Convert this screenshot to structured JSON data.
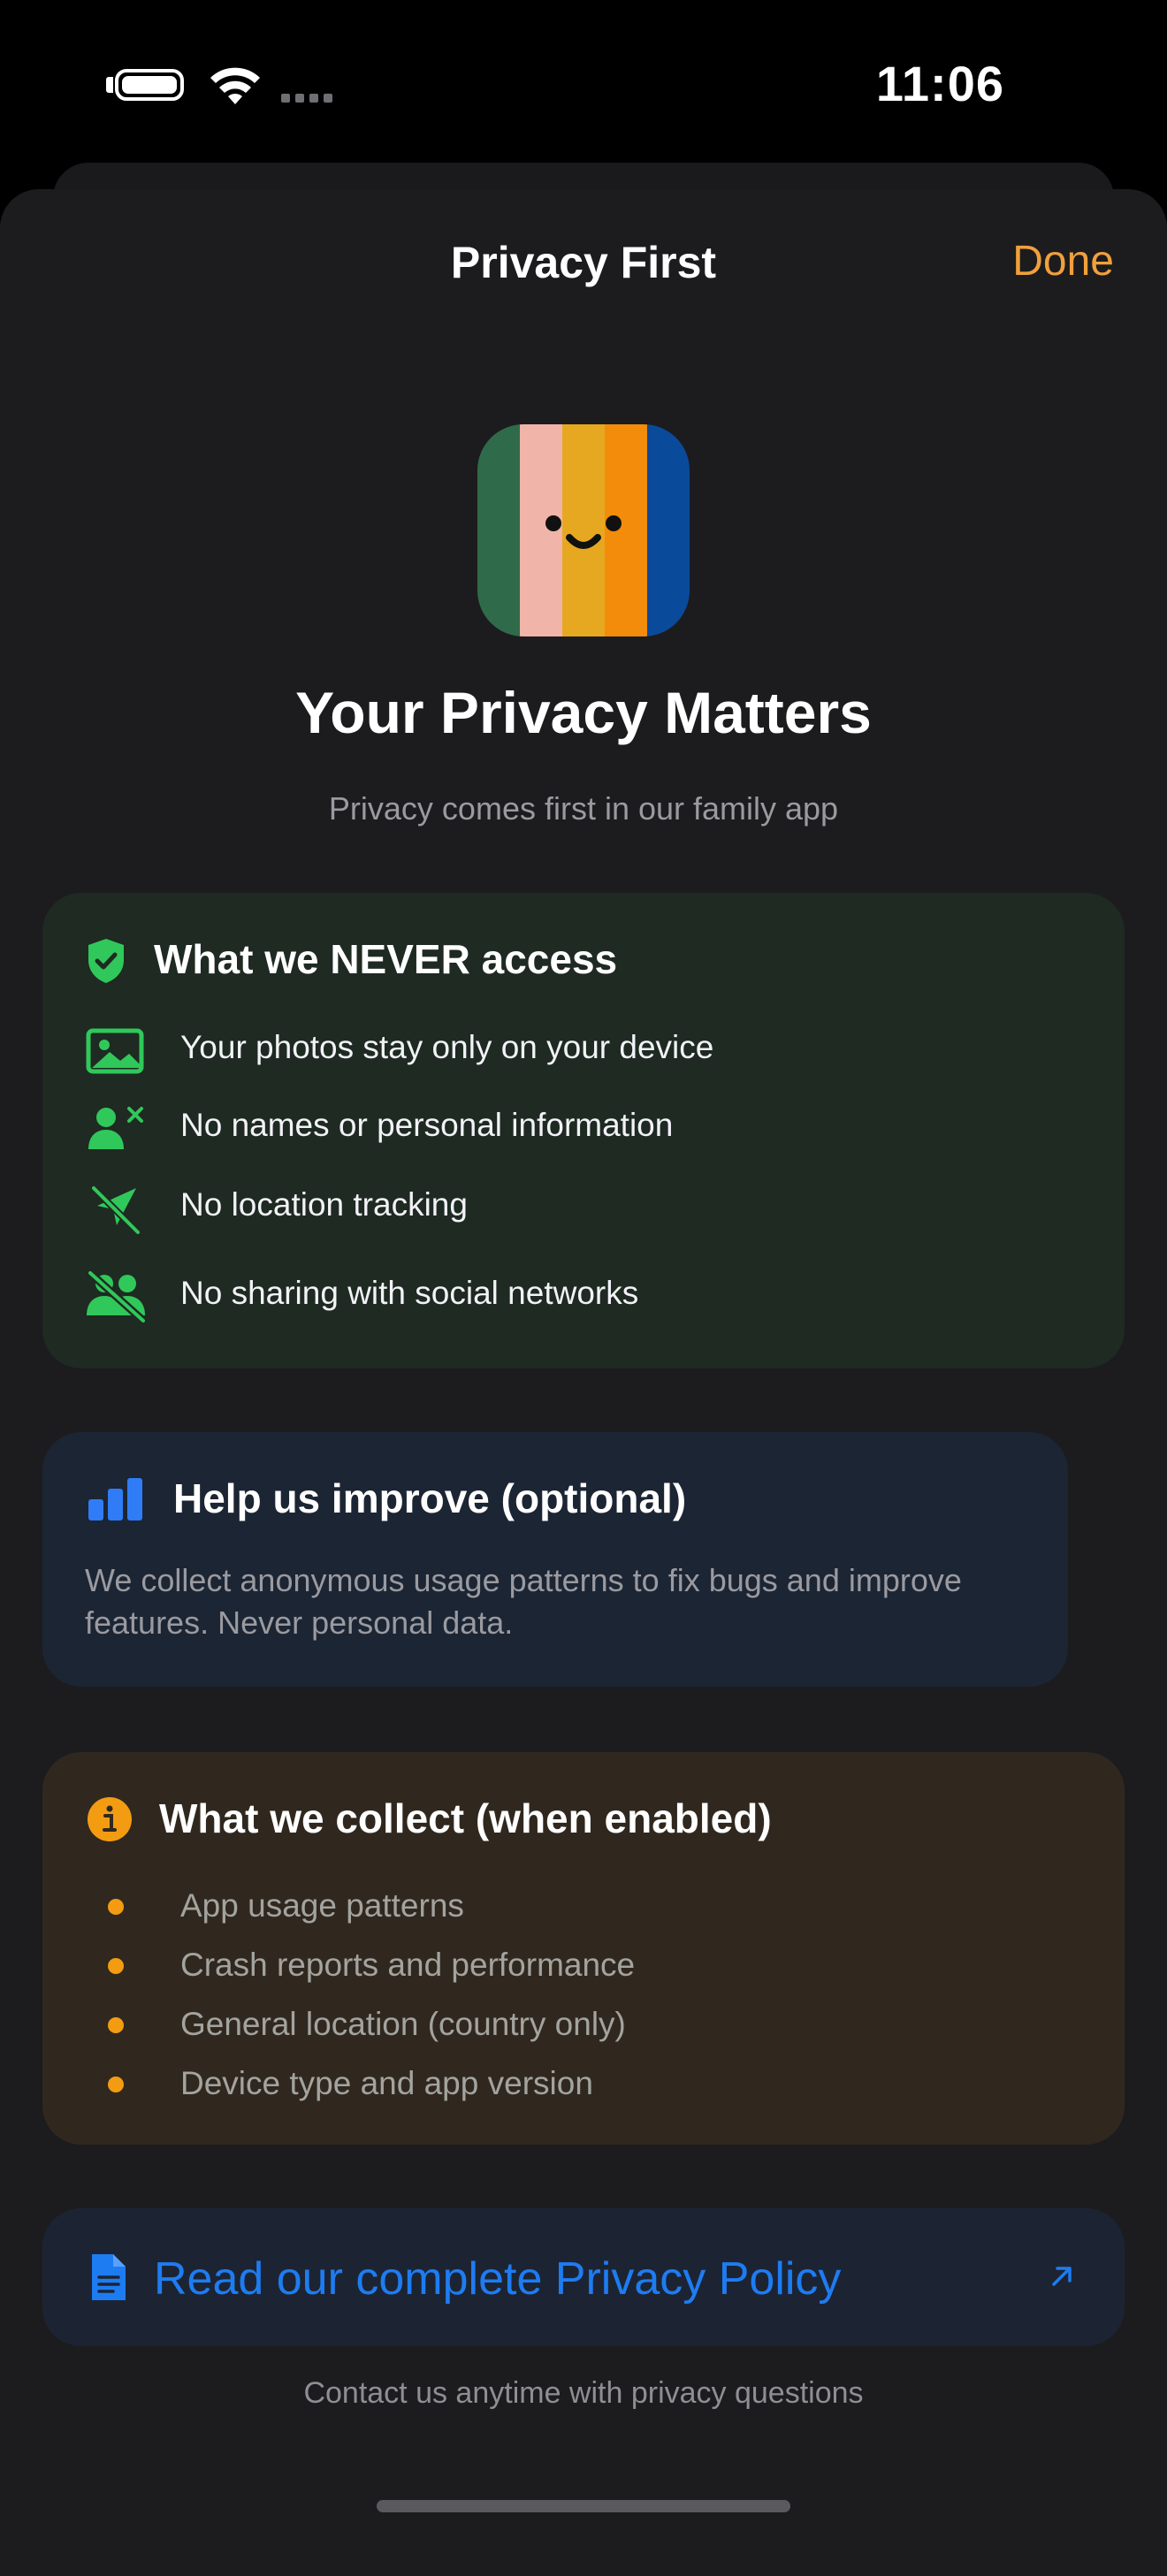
{
  "status_bar": {
    "time": "11:06"
  },
  "nav": {
    "title": "Privacy First",
    "done_label": "Done"
  },
  "app_icon": {
    "stripe_colors": [
      "#2f6b4a",
      "#f0b4a8",
      "#e6a820",
      "#f28c0a",
      "#0a4a9a"
    ]
  },
  "hero": {
    "title": "Your Privacy Matters",
    "subtitle": "Privacy comes first in our family app"
  },
  "never_card": {
    "title": "What we NEVER access",
    "accent": "#30c85a",
    "items": [
      {
        "icon": "photo-icon",
        "text": "Your photos stay only on your device"
      },
      {
        "icon": "person-x-icon",
        "text": "No names or personal information"
      },
      {
        "icon": "location-slash-icon",
        "text": "No location tracking"
      },
      {
        "icon": "people-slash-icon",
        "text": "No sharing with social networks"
      }
    ]
  },
  "help_card": {
    "title": "Help us improve (optional)",
    "body": "We collect anonymous usage patterns to fix bugs and improve features. Never personal data.",
    "accent": "#2f7cf6"
  },
  "collect_card": {
    "title": "What we collect (when enabled)",
    "accent": "#f39c12",
    "items": [
      "App usage patterns",
      "Crash reports and performance",
      "General location (country only)",
      "Device type and app version"
    ]
  },
  "policy_link": {
    "label": "Read our complete Privacy Policy",
    "accent": "#1e7cf2"
  },
  "footer": {
    "text": "Contact us anytime with privacy questions"
  }
}
